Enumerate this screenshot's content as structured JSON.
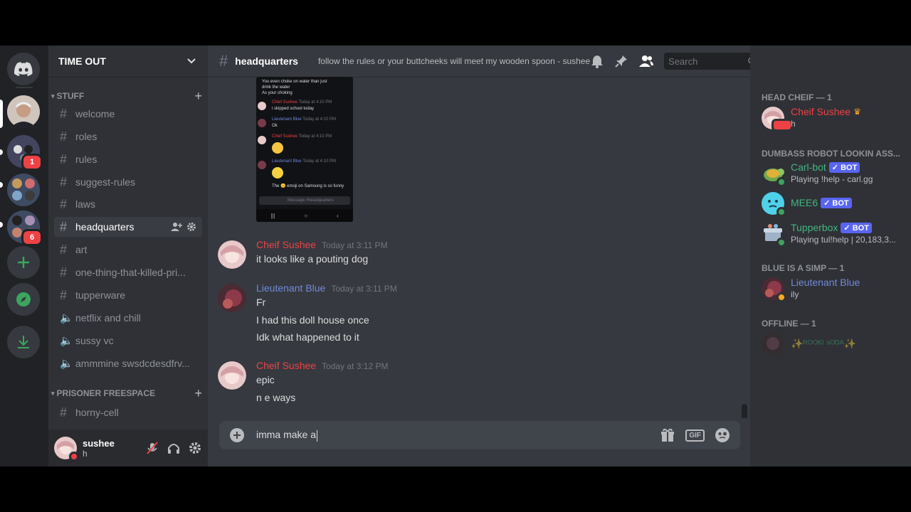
{
  "servers": {
    "items": [
      {
        "name": "home",
        "badge": ""
      },
      {
        "name": "server-1",
        "badge": ""
      },
      {
        "name": "server-2",
        "badge": "1"
      },
      {
        "name": "server-3",
        "badge": ""
      },
      {
        "name": "server-4",
        "badge": "6"
      }
    ]
  },
  "guild": {
    "name": "TIME OUT"
  },
  "categories": [
    {
      "label": "STUFF"
    },
    {
      "label": "PRISONER FREESPACE"
    }
  ],
  "channels": [
    {
      "name": "welcome",
      "type": "text"
    },
    {
      "name": "roles",
      "type": "text"
    },
    {
      "name": "rules",
      "type": "text"
    },
    {
      "name": "suggest-rules",
      "type": "text"
    },
    {
      "name": "laws",
      "type": "text"
    },
    {
      "name": "headquarters",
      "type": "text",
      "active": true
    },
    {
      "name": "art",
      "type": "text"
    },
    {
      "name": "one-thing-that-killed-pri...",
      "type": "text"
    },
    {
      "name": "tupperware",
      "type": "text"
    },
    {
      "name": "netflix and chill",
      "type": "voice"
    },
    {
      "name": "sussy vc",
      "type": "voice"
    },
    {
      "name": "ammmine swsdcdesdfrv...",
      "type": "voice"
    },
    {
      "name": "horny-cell",
      "type": "text"
    }
  ],
  "user_panel": {
    "username": "sushee",
    "status": "h"
  },
  "topbar": {
    "channel": "headquarters",
    "topic": "follow the rules or your buttcheeks will meet my wooden spoon - sushee",
    "search_placeholder": "Search"
  },
  "screenshot_preview": {
    "lines": [
      {
        "text": "You even choke on water than just",
        "color": "#dcddde"
      },
      {
        "text": "drink the water",
        "color": "#dcddde"
      },
      {
        "text": "As your choking",
        "color": "#dcddde"
      },
      {
        "author": "Chief Sushee",
        "time": "Today at 4:10 PM",
        "color": "#ed4245",
        "text": "i skipped school today"
      },
      {
        "author": "Lieutenant Blue",
        "time": "Today at 4:10 PM",
        "color": "#7289da",
        "text": "Ok"
      },
      {
        "author": "Chief Sushee",
        "time": "Today at 4:10 PM",
        "color": "#ed4245",
        "text": ""
      },
      {
        "author": "Lieutenant Blue",
        "time": "Today at 4:10 PM",
        "color": "#7289da",
        "text": ""
      },
      {
        "text": "The 😐 emoji on Samsung is so funny",
        "color": "#dcddde"
      }
    ],
    "composer_placeholder": "Message #headquarters"
  },
  "messages": [
    {
      "author": "Cheif Sushee",
      "color": "#ed4245",
      "time": "Today at 3:11 PM",
      "lines": [
        "it looks like a pouting dog"
      ]
    },
    {
      "author": "Lieutenant Blue",
      "color": "#7289da",
      "time": "Today at 3:11 PM",
      "lines": [
        "Fr",
        "I had this doll house once",
        "Idk what happened to it"
      ]
    },
    {
      "author": "Cheif Sushee",
      "color": "#ed4245",
      "time": "Today at 3:12 PM",
      "lines": [
        "epic",
        "n e ways"
      ]
    }
  ],
  "composer": {
    "value": "imma make a",
    "gif_label": "GIF"
  },
  "members": {
    "groups": [
      {
        "label": "HEAD CHEIF — 1",
        "members": [
          {
            "name": "Cheif Sushee",
            "color": "#ed4245",
            "status": "h",
            "crown": true,
            "bot": false,
            "presence": "dnd"
          }
        ]
      },
      {
        "label": "DUMBASS ROBOT LOOKIN ASS...",
        "members": [
          {
            "name": "Carl-bot",
            "color": "#43b581",
            "status": "Playing !help - carl.gg",
            "bot": true,
            "bot_label": "✓ BOT",
            "presence": "online"
          },
          {
            "name": "MEE6",
            "color": "#43b581",
            "status": "",
            "bot": true,
            "bot_label": "✓ BOT",
            "presence": "online"
          },
          {
            "name": "Tupperbox",
            "color": "#43b581",
            "status": "Playing tul!help | 20,183,3...",
            "bot": true,
            "bot_label": "✓ BOT",
            "presence": "online"
          }
        ]
      },
      {
        "label": "BLUE IS A SIMP — 1",
        "members": [
          {
            "name": "Lieutenant Blue",
            "color": "#7289da",
            "status": "ily",
            "bot": false,
            "presence": "idle"
          }
        ]
      },
      {
        "label": "OFFLINE — 1",
        "members": [
          {
            "name": "✨ᴿᴼᴼᴷᴵ ˢᴼᴰᴬ✨",
            "color": "#3b6e4a",
            "status": "",
            "bot": false,
            "presence": "offline"
          }
        ]
      }
    ]
  },
  "colors": {
    "accent": "#5865f2",
    "online": "#3ba55d",
    "dnd": "#ed4245",
    "idle": "#faa81a"
  }
}
